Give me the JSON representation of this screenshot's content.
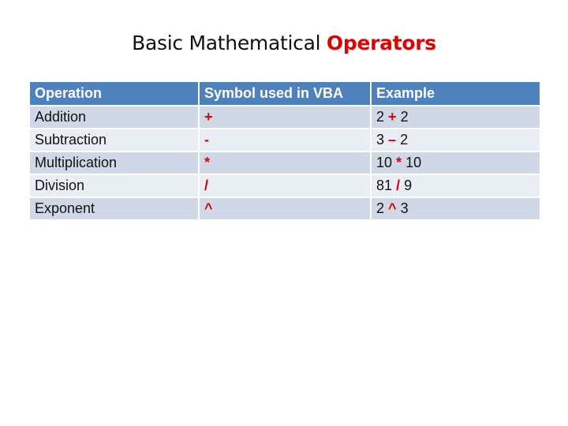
{
  "title": {
    "prefix": "Basic Mathematical ",
    "accent": "Operators"
  },
  "colors": {
    "accent": "#e00000",
    "header_bg": "#4f81bd",
    "row_dark": "#d0d8e8",
    "row_light": "#e9edf4"
  },
  "table": {
    "headers": [
      "Operation",
      "Symbol used in VBA",
      "Example"
    ],
    "rows": [
      {
        "operation": "Addition",
        "symbol": "+",
        "example_left": "2",
        "example_op": "+",
        "example_right": "2"
      },
      {
        "operation": "Subtraction",
        "symbol": "-",
        "example_left": "3",
        "example_op": "–",
        "example_right": "2"
      },
      {
        "operation": "Multiplication",
        "symbol": "*",
        "example_left": "10",
        "example_op": "*",
        "example_right": "10"
      },
      {
        "operation": "Division",
        "symbol": "/",
        "example_left": "81",
        "example_op": "/",
        "example_right": "9"
      },
      {
        "operation": "Exponent",
        "symbol": "^",
        "example_left": "2",
        "example_op": "^",
        "example_right": "3"
      }
    ]
  }
}
